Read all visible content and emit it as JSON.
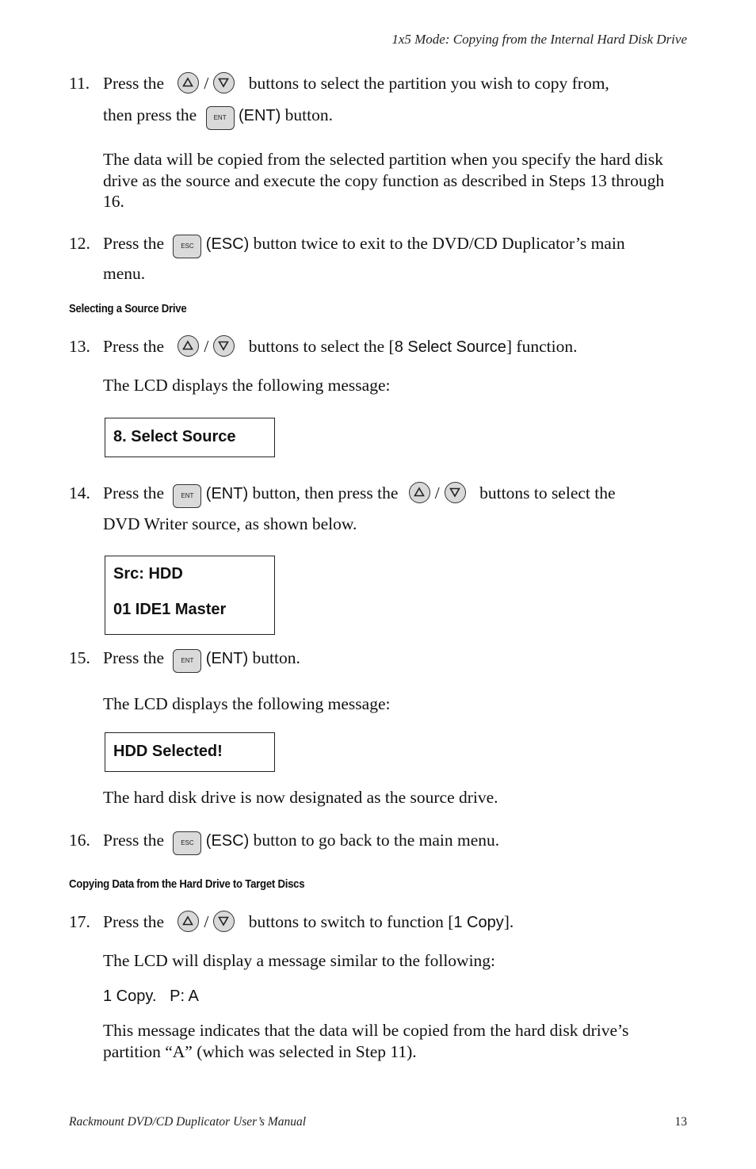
{
  "header": {
    "running_title": "1x5 Mode: Copying from the Internal Hard Disk Drive"
  },
  "footer": {
    "manual_title": "Rackmount DVD/CD Duplicator User’s Manual",
    "page_number": "13"
  },
  "buttons": {
    "up": "up-arrow",
    "down": "down-arrow",
    "ent": "ENT",
    "esc": "ESC"
  },
  "steps": {
    "s11": {
      "num": "11.",
      "a": "Press the",
      "b": "buttons to select the partition you wish to copy from,",
      "c": "then press the",
      "d": "(ENT)",
      "e": "button.",
      "note": "The data will be copied from the selected partition when you specify the hard disk drive as the source and execute the copy function as described in Steps 13 through 16."
    },
    "s12": {
      "num": "12.",
      "a": "Press the",
      "b": "(ESC)",
      "c": "button twice to exit to the DVD/CD Duplicator’s main",
      "d": "menu."
    },
    "s13": {
      "num": "13.",
      "a": "Press the",
      "b": "buttons to select the [",
      "c": "8 Select Source",
      "d": "] function.",
      "note": "The LCD displays the following message:",
      "lcd": [
        "8. Select Source"
      ]
    },
    "s14": {
      "num": "14.",
      "a": "Press the",
      "b": "(ENT)",
      "c": "button, then press the",
      "d": "buttons to select the",
      "e": "DVD Writer source, as shown below.",
      "lcd": [
        "Src: HDD",
        "01 IDE1 Master"
      ]
    },
    "s15": {
      "num": "15.",
      "a": "Press the",
      "b": "(ENT)",
      "c": "button.",
      "note": "The LCD displays the following message:",
      "lcd": [
        "HDD Selected!"
      ],
      "after": "The hard disk drive is now designated as the source drive."
    },
    "s16": {
      "num": "16.",
      "a": "Press the",
      "b": "(ESC)",
      "c": "button to go back to the main menu."
    },
    "s17": {
      "num": "17.",
      "a": "Press the",
      "b": "buttons to switch to function [",
      "c": "1 Copy",
      "d": "].",
      "note": "The LCD will display a message similar to the following:",
      "lcd_text": "1 Copy.   P: A",
      "after": "This message indicates that the data will be copied from the hard disk drive’s partition “A” (which was selected in Step 11)."
    }
  },
  "headings": {
    "select_source": "Selecting a Source Drive",
    "copy_data": "Copying Data from the Hard Drive to Target Discs"
  },
  "slash": "/"
}
